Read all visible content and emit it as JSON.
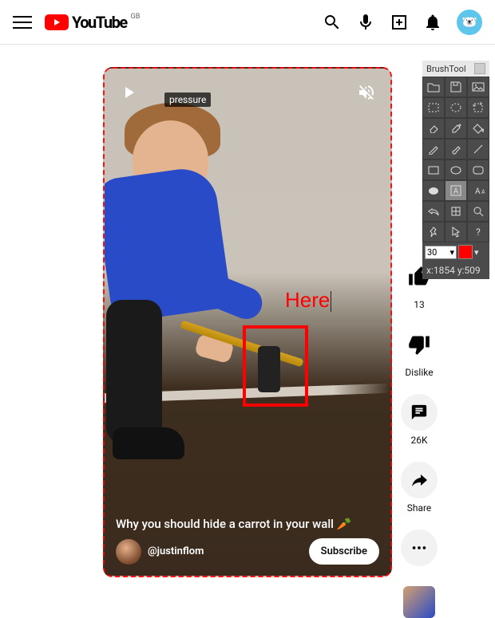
{
  "header": {
    "brand": "YouTube",
    "region": "GB"
  },
  "short": {
    "tag": "pressure",
    "annotation": "Here",
    "caption": "Why you should hide a carrot in your wall 🥕",
    "channel": "@justinflom",
    "subscribe": "Subscribe"
  },
  "actions": {
    "like_count": "13",
    "dislike": "Dislike",
    "comments": "26K",
    "share": "Share"
  },
  "tool": {
    "title": "BrushTool",
    "size": "30",
    "coords": "x:1854 y:509",
    "color": "#ff0000"
  }
}
